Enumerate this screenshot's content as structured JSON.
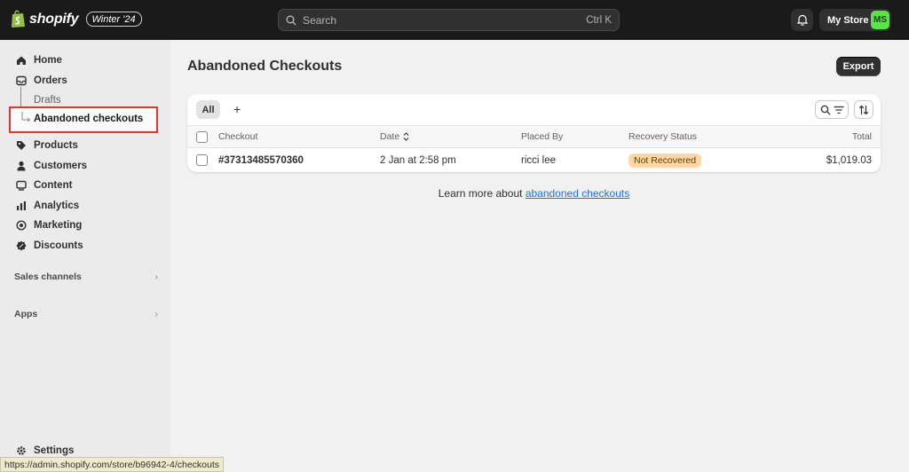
{
  "topbar": {
    "brand": "shopify",
    "edition": "Winter '24",
    "search_placeholder": "Search",
    "search_shortcut": "Ctrl K",
    "store_name": "My Store",
    "store_initials": "MS"
  },
  "sidebar": {
    "items": [
      {
        "label": "Home",
        "icon": "home-icon"
      },
      {
        "label": "Orders",
        "icon": "orders-icon"
      },
      {
        "label": "Products",
        "icon": "tag-icon"
      },
      {
        "label": "Customers",
        "icon": "person-icon"
      },
      {
        "label": "Content",
        "icon": "content-icon"
      },
      {
        "label": "Analytics",
        "icon": "bar-chart-icon"
      },
      {
        "label": "Marketing",
        "icon": "target-icon"
      },
      {
        "label": "Discounts",
        "icon": "discount-icon"
      }
    ],
    "sub_items": {
      "drafts": "Drafts",
      "abandoned": "Abandoned checkouts"
    },
    "sections": {
      "sales_channels": "Sales channels",
      "apps": "Apps"
    },
    "settings": "Settings"
  },
  "main": {
    "title": "Abandoned Checkouts",
    "export_label": "Export",
    "tabs": {
      "all": "All",
      "add": "+"
    },
    "columns": {
      "checkout": "Checkout",
      "date": "Date",
      "placed_by": "Placed By",
      "recovery_status": "Recovery Status",
      "total": "Total"
    },
    "rows": [
      {
        "checkout": "#37313485570360",
        "date": "2 Jan at 2:58 pm",
        "placed_by": "ricci lee",
        "recovery_status": "Not Recovered",
        "total": "$1,019.03"
      }
    ],
    "learn_more_prefix": "Learn more about ",
    "learn_more_link": "abandoned checkouts"
  },
  "statusbar": {
    "url": "https://admin.shopify.com/store/b96942-4/checkouts"
  },
  "colors": {
    "topbar": "#1a1a1a",
    "sidebar": "#ebebeb",
    "highlight_border": "#e63232",
    "status_badge": "#ffd6a4",
    "link": "#2c6ecb",
    "avatar": "#5be44a"
  }
}
